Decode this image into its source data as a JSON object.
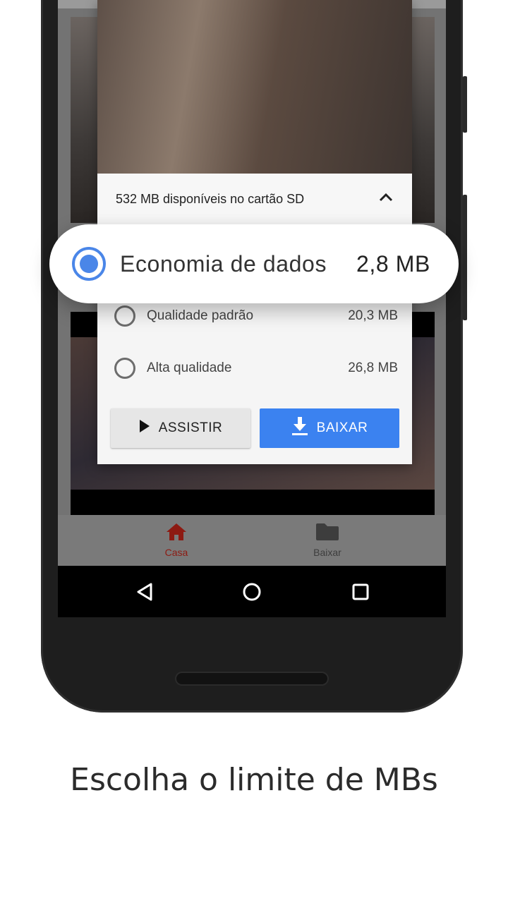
{
  "dialog": {
    "storage_text": "532 MB disponíveis no cartão SD",
    "options": [
      {
        "label": "Economia de dados",
        "size": "2,8 MB",
        "selected": true
      },
      {
        "label": "Qualidade padrão",
        "size": "20,3 MB",
        "selected": false
      },
      {
        "label": "Alta qualidade",
        "size": "26,8 MB",
        "selected": false
      }
    ],
    "watch_label": "ASSISTIR",
    "download_label": "BAIXAR"
  },
  "bottom_nav": {
    "items": [
      {
        "label": "Casa",
        "icon": "home-icon",
        "active": true
      },
      {
        "label": "Baixar",
        "icon": "folder-icon",
        "active": false
      }
    ]
  },
  "system_nav": {
    "icons": [
      "back-icon",
      "home-circle-icon",
      "recents-icon"
    ]
  },
  "caption": "Escolha o limite de MBs",
  "colors": {
    "accent_blue": "#3b82f0",
    "radio_blue": "#4a86e8",
    "active_nav": "#8d1a12"
  }
}
